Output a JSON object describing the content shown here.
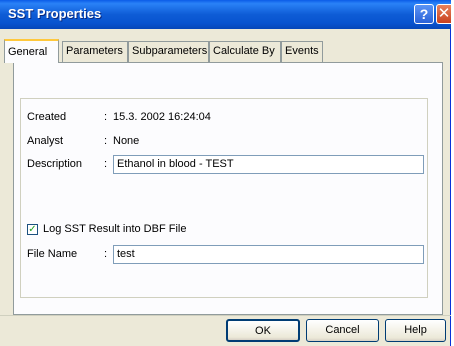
{
  "window": {
    "title": "SST Properties",
    "help_glyph": "?",
    "close_glyph": "✕"
  },
  "tabs": [
    {
      "label": "General",
      "active": true
    },
    {
      "label": "Parameters",
      "active": false
    },
    {
      "label": "Subparameters",
      "active": false
    },
    {
      "label": "Calculate By",
      "active": false
    },
    {
      "label": "Events",
      "active": false
    }
  ],
  "general": {
    "created_label": "Created",
    "created_value": "15.3. 2002 16:24:04",
    "analyst_label": "Analyst",
    "analyst_value": "None",
    "description_label": "Description",
    "description_value": "Ethanol in blood - TEST",
    "separator": ":",
    "log_checkbox_label": "Log SST Result into DBF File",
    "log_checkbox_checked": true,
    "file_name_label": "File Name",
    "file_name_value": "test"
  },
  "buttons": {
    "ok": "OK",
    "cancel": "Cancel",
    "help": "Help"
  },
  "colors": {
    "titlebar": "#0853cf",
    "face": "#ece9d8",
    "active_tab_accent": "#ffc83c"
  }
}
